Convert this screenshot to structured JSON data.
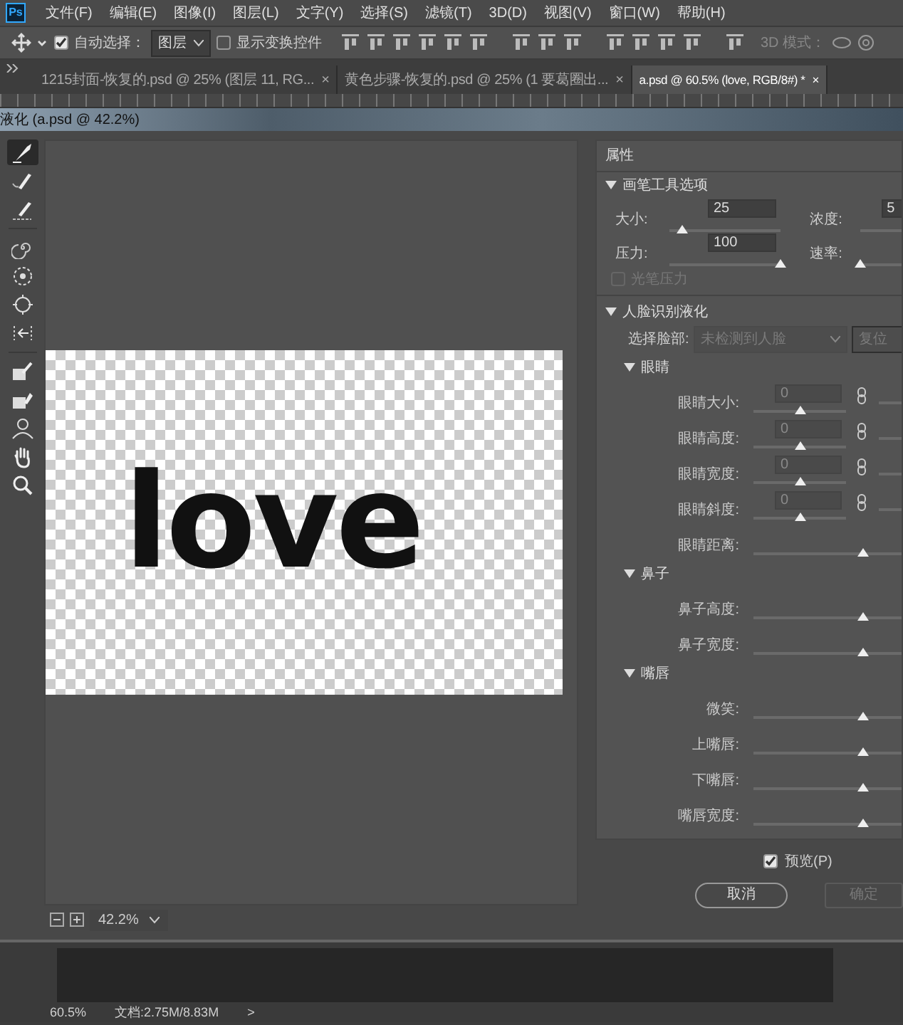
{
  "app": {
    "logo": "Ps",
    "menu": [
      "文件(F)",
      "编辑(E)",
      "图像(I)",
      "图层(L)",
      "文字(Y)",
      "选择(S)",
      "滤镜(T)",
      "3D(D)",
      "视图(V)",
      "窗口(W)",
      "帮助(H)"
    ]
  },
  "options_bar": {
    "auto_select": {
      "label": "自动选择：",
      "checked": true
    },
    "target_dropdown": "图层",
    "show_transform": {
      "label": "显示变换控件",
      "checked": false
    },
    "mode_3d": "3D 模式："
  },
  "tabs": [
    {
      "label": "1215封面-恢复的.psd @ 25% (图层 11, RG...",
      "close": "×",
      "selected": false
    },
    {
      "label": "黄色步骤-恢复的.psd @ 25% (1 要葛圈出...",
      "close": "×",
      "selected": false
    },
    {
      "label": "a.psd @ 60.5% (love, RGB/8#) *",
      "close": "×",
      "selected": true
    }
  ],
  "dialog": {
    "title": "液化 (a.psd @ 42.2%)",
    "tools": [
      {
        "kind": "warp",
        "selected": true
      },
      {
        "kind": "reconstruct",
        "selected": false
      },
      {
        "kind": "smooth",
        "selected": false
      },
      {
        "kind": "twirl",
        "selected": false
      },
      {
        "kind": "pucker",
        "selected": false
      },
      {
        "kind": "bloat",
        "selected": false
      },
      {
        "kind": "push",
        "selected": false
      },
      {
        "kind": "freeze",
        "selected": false
      },
      {
        "kind": "thaw",
        "selected": false
      },
      {
        "kind": "face",
        "selected": false
      },
      {
        "kind": "hand",
        "selected": false
      },
      {
        "kind": "zoom",
        "selected": false
      }
    ],
    "canvas": {
      "text": "love"
    },
    "zoom": {
      "value": "42.2%"
    },
    "properties": {
      "title": "属性",
      "brush_section": {
        "title": "画笔工具选项",
        "expanded": true,
        "size": {
          "label": "大小:",
          "value": "25",
          "level": 0.12
        },
        "density": {
          "label": "浓度:",
          "value": "5"
        },
        "pressure": {
          "label": "压力:",
          "value": "100",
          "level": 1
        },
        "rate": {
          "label": "速率:",
          "level": 0
        },
        "stylus": {
          "label": "光笔压力",
          "checked": false,
          "disabled": true
        }
      },
      "face_section": {
        "title": "人脸识别液化",
        "expanded": true,
        "disabled": true,
        "select_label": "选择脸部:",
        "face_dropdown": "未检测到人脸",
        "reset_button": "复位",
        "groups": [
          {
            "title": "眼睛",
            "expanded": true,
            "rows": [
              {
                "kind": "pair",
                "label": "眼睛大小:",
                "value": "0",
                "level": 0.5
              },
              {
                "kind": "pair",
                "label": "眼睛高度:",
                "value": "0",
                "level": 0.5
              },
              {
                "kind": "pair",
                "label": "眼睛宽度:",
                "value": "0",
                "level": 0.5
              },
              {
                "kind": "pair",
                "label": "眼睛斜度:",
                "value": "0",
                "level": 0.5
              },
              {
                "kind": "single",
                "label": "眼睛距离:",
                "level": 0.5
              }
            ]
          },
          {
            "title": "鼻子",
            "expanded": true,
            "rows": [
              {
                "kind": "single",
                "label": "鼻子高度:",
                "level": 0.5
              },
              {
                "kind": "single",
                "label": "鼻子宽度:",
                "level": 0.5
              }
            ]
          },
          {
            "title": "嘴唇",
            "expanded": true,
            "rows": [
              {
                "kind": "single",
                "label": "微笑:",
                "level": 0.5
              },
              {
                "kind": "single",
                "label": "上嘴唇:",
                "level": 0.5
              },
              {
                "kind": "single",
                "label": "下嘴唇:",
                "level": 0.5
              },
              {
                "kind": "single",
                "label": "嘴唇宽度:",
                "level": 0.5
              }
            ]
          }
        ]
      }
    },
    "preview": {
      "label": "预览(P)",
      "checked": true
    },
    "buttons": [
      {
        "label": "取消",
        "disabled": false
      },
      {
        "label": "确定",
        "disabled": true
      }
    ]
  },
  "status_bar": {
    "zoom": "60.5%",
    "doc": "文档:2.75M/8.83M",
    "arrow": ">"
  }
}
